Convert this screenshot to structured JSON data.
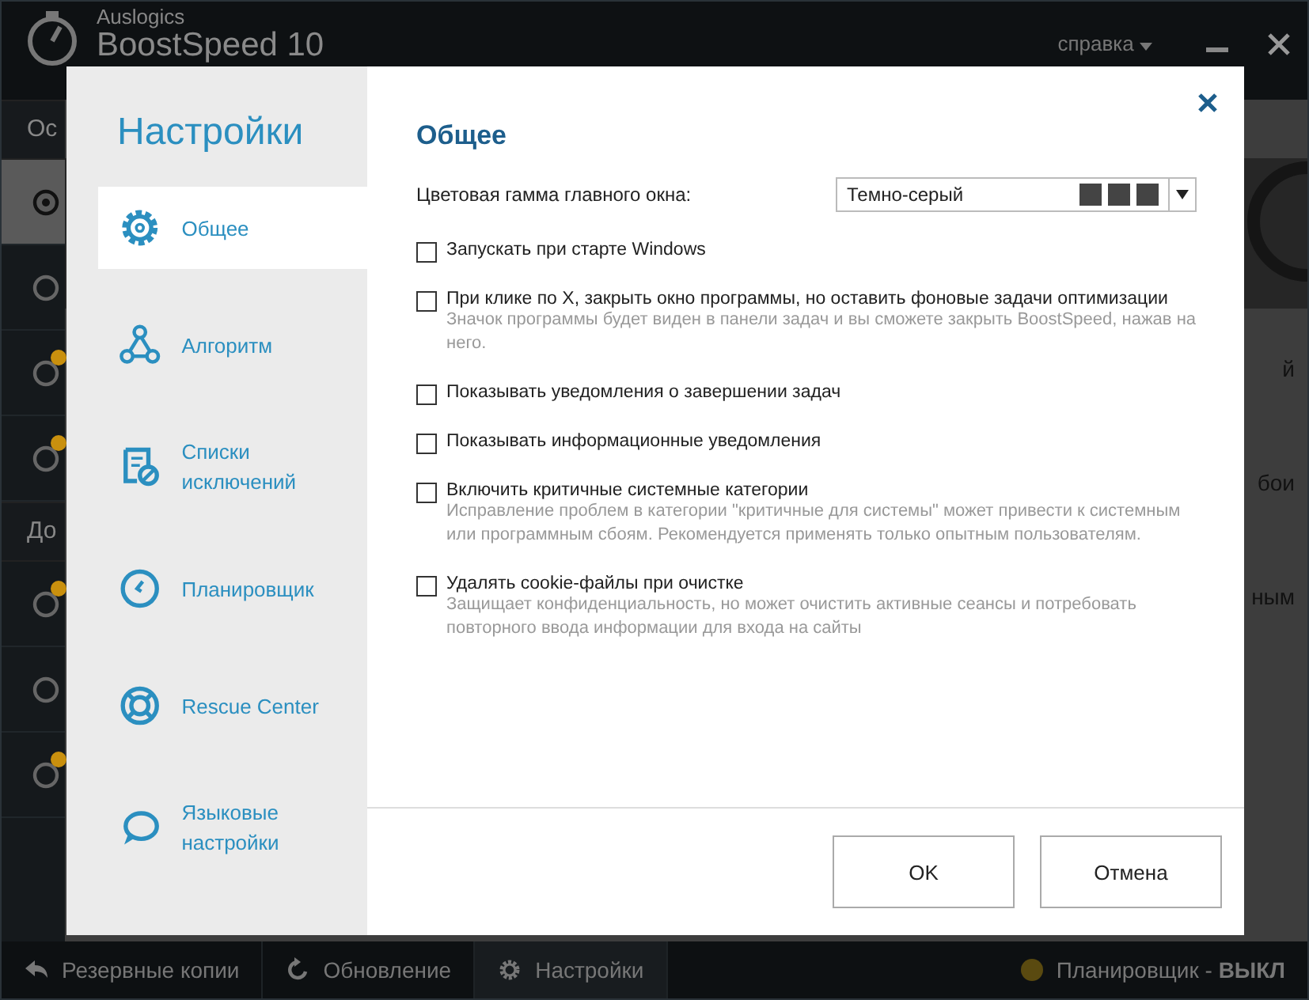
{
  "app": {
    "brand": "Auslogics",
    "product": "BoostSpeed 10",
    "help_menu": "справка",
    "section_main": "Ос",
    "section_extra": "До",
    "side_items": [
      {
        "selected": true,
        "badge": false
      },
      {
        "selected": false,
        "badge": false
      },
      {
        "selected": false,
        "badge": true
      },
      {
        "selected": false,
        "badge": true
      },
      {
        "selected": false,
        "badge": true
      },
      {
        "selected": false,
        "badge": false
      },
      {
        "selected": false,
        "badge": true
      }
    ],
    "behind_texts": [
      "й",
      "бои",
      "ным"
    ]
  },
  "dialog": {
    "title": "Настройки",
    "nav": [
      {
        "kind": "gear",
        "label": "Общее",
        "selected": true
      },
      {
        "kind": "algorithm",
        "label": "Алгоритм",
        "selected": false
      },
      {
        "kind": "list",
        "label": "Списки исключений",
        "selected": false
      },
      {
        "kind": "clock",
        "label": "Планировщик",
        "selected": false
      },
      {
        "kind": "lifebuoy",
        "label": "Rescue Center",
        "selected": false
      },
      {
        "kind": "speech",
        "label": "Языковые настройки",
        "selected": false
      }
    ],
    "heading": "Общее",
    "color_scheme": {
      "label": "Цветовая гамма главного окна:",
      "value": "Темно-серый"
    },
    "options": [
      {
        "label": "Запускать при старте Windows",
        "checked": false
      },
      {
        "label": "При клике по X, закрыть окно программы, но оставить фоновые задачи оптимизации",
        "hint": "Значок программы будет виден в панели задач и вы сможете закрыть BoostSpeed, нажав на него.",
        "checked": false
      },
      {
        "label": "Показывать уведомления о завершении задач",
        "checked": false
      },
      {
        "label": "Показывать информационные уведомления",
        "checked": false
      },
      {
        "label": "Включить критичные системные категории",
        "hint": "Исправление проблем в категории \"критичные для системы\" может привести к системным или программным сбоям. Рекомендуется применять только опытным пользователям.",
        "checked": false
      },
      {
        "label": "Удалять cookie-файлы при очистке",
        "hint": "Защищает конфиденциальность, но может очистить активные сеансы и потребовать повторного ввода информации для входа на сайты",
        "checked": false
      }
    ],
    "buttons": [
      "OK",
      "Отмена"
    ]
  },
  "bottom_bar": {
    "items": [
      {
        "kind": "back",
        "label": "Резервные копии",
        "selected": false
      },
      {
        "kind": "refresh",
        "label": "Обновление",
        "selected": false
      },
      {
        "kind": "gear",
        "label": "Настройки",
        "selected": true
      }
    ],
    "scheduler": {
      "label": "Планировщик - ",
      "value": "ВЫКЛ",
      "on": false
    }
  }
}
